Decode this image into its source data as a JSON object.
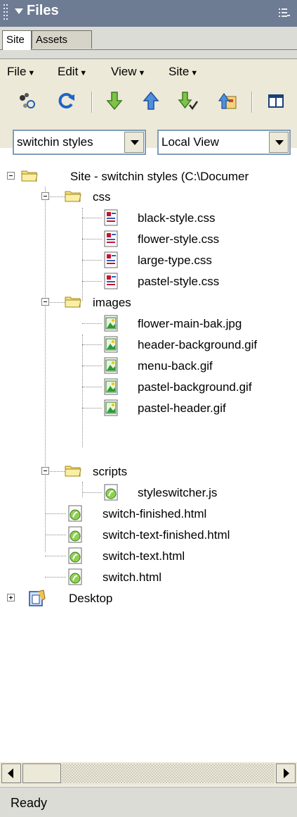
{
  "panel": {
    "title": "Files",
    "tabs": [
      "Site",
      "Assets"
    ]
  },
  "menu": [
    "File",
    "Edit",
    "View",
    "Site"
  ],
  "toolbar": {
    "icons": [
      "connect-icon",
      "refresh-icon",
      "get-files-icon",
      "put-files-icon",
      "check-out-icon",
      "check-in-icon",
      "expand-view-icon"
    ]
  },
  "site_select": {
    "value": "switchin styles"
  },
  "view_select": {
    "value": "Local View"
  },
  "tree": {
    "root": "Site - switchin styles (C:\\Documer",
    "folders": [
      {
        "name": "css",
        "files": [
          "black-style.css",
          "flower-style.css",
          "large-type.css",
          "pastel-style.css"
        ]
      },
      {
        "name": "images",
        "files": [
          "flower-main-bak.jpg",
          "header-background.gif",
          "menu-back.gif",
          "pastel-background.gif",
          "pastel-header.gif"
        ]
      },
      {
        "name": "scripts",
        "files": [
          "styleswitcher.js"
        ]
      }
    ],
    "root_files": [
      "switch-finished.html",
      "switch-text-finished.html",
      "switch-text.html",
      "switch.html"
    ],
    "desktop": "Desktop"
  },
  "status": "Ready"
}
